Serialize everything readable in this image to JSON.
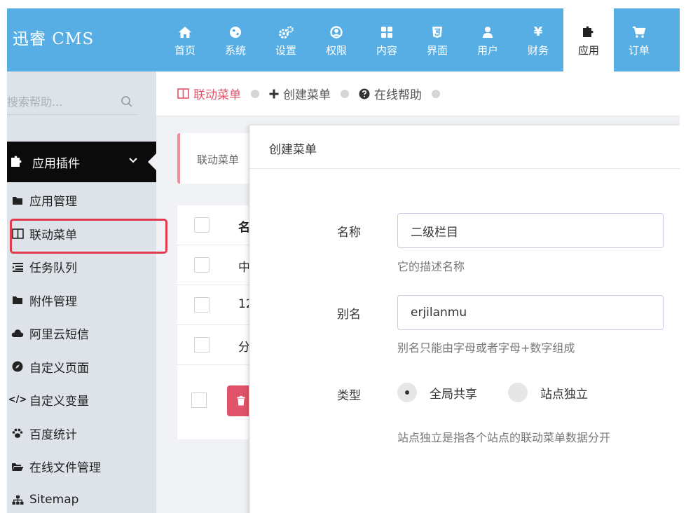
{
  "header": {
    "brand": "迅睿 CMS",
    "nav": [
      {
        "label": "首页",
        "icon": "home-icon"
      },
      {
        "label": "系统",
        "icon": "globe-icon"
      },
      {
        "label": "设置",
        "icon": "gears-icon"
      },
      {
        "label": "权限",
        "icon": "user-circle-icon"
      },
      {
        "label": "内容",
        "icon": "grid-icon"
      },
      {
        "label": "界面",
        "icon": "html5-icon"
      },
      {
        "label": "用户",
        "icon": "user-icon"
      },
      {
        "label": "财务",
        "icon": "yen-icon",
        "glyph": "¥"
      },
      {
        "label": "应用",
        "icon": "puzzle-icon",
        "active": true
      },
      {
        "label": "订单",
        "icon": "cart-icon"
      }
    ]
  },
  "sidebar": {
    "search_placeholder": "搜索帮助...",
    "section": "应用插件",
    "items": [
      {
        "label": "应用管理",
        "icon": "folder-icon"
      },
      {
        "label": "联动菜单",
        "icon": "columns-icon",
        "current": true
      },
      {
        "label": "任务队列",
        "icon": "list-icon"
      },
      {
        "label": "附件管理",
        "icon": "folder-icon"
      },
      {
        "label": "阿里云短信",
        "icon": "cloud-icon"
      },
      {
        "label": "自定义页面",
        "icon": "compass-icon"
      },
      {
        "label": "自定义变量",
        "icon": "code-icon",
        "glyph": "</>"
      },
      {
        "label": "百度统计",
        "icon": "paw-icon"
      },
      {
        "label": "在线文件管理",
        "icon": "folder-open-icon"
      },
      {
        "label": "Sitemap",
        "icon": "sitemap-icon"
      }
    ]
  },
  "breadcrumb": [
    {
      "label": "联动菜单",
      "icon": "columns-icon",
      "active": true
    },
    {
      "label": "创建菜单",
      "icon": "plus-icon"
    },
    {
      "label": "在线帮助",
      "icon": "question-icon"
    }
  ],
  "note": "联动菜单",
  "table": {
    "header": "名",
    "rows": [
      "中",
      "12",
      "分"
    ]
  },
  "modal": {
    "title": "创建菜单",
    "fields": {
      "name_label": "名称",
      "name_value": "二级栏目",
      "name_help": "它的描述名称",
      "alias_label": "别名",
      "alias_value": "erjilanmu",
      "alias_help": "别名只能由字母或者字母+数字组成",
      "type_label": "类型",
      "type_options": [
        "全局共享",
        "站点独立"
      ],
      "type_help": "站点独立是指各个站点的联动菜单数据分开"
    }
  },
  "colors": {
    "header": "#57aee5",
    "sidebar": "#dde3e9",
    "accent": "#e3546a",
    "danger": "#e0536a"
  }
}
